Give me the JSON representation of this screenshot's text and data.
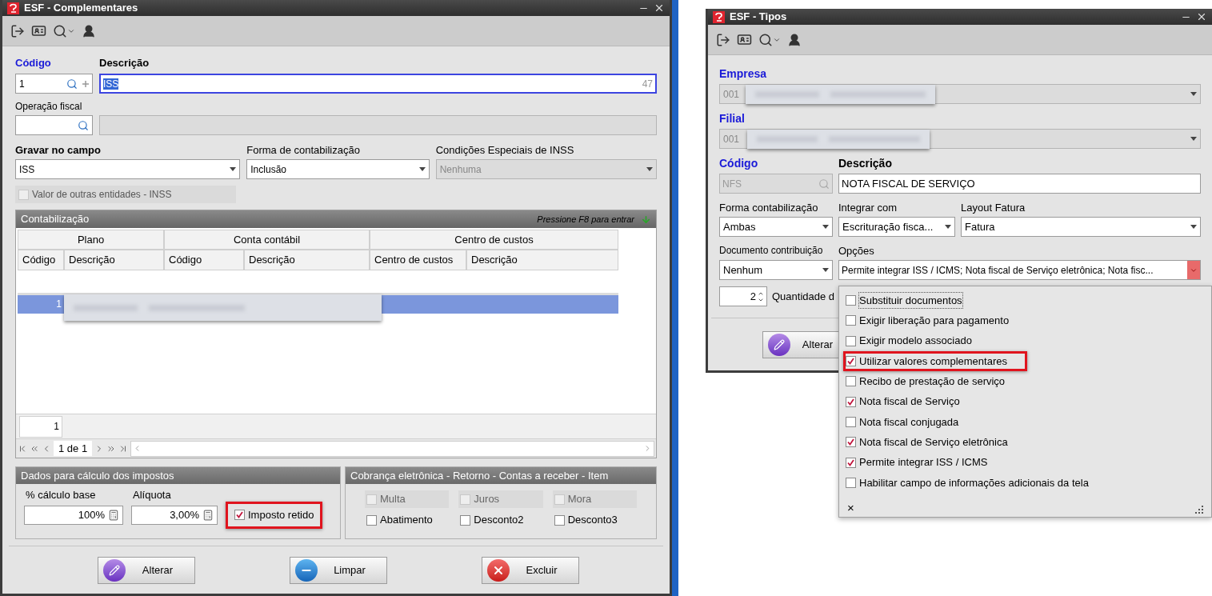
{
  "complementares_window": {
    "title": "ESF - Complementares",
    "codigo": {
      "label": "Código",
      "value": "1"
    },
    "descricao": {
      "label": "Descrição",
      "value": "ISS",
      "counter": "47",
      "focused": true,
      "text_selected": true
    },
    "operacao_fiscal": {
      "label": "Operação fiscal"
    },
    "selects": [
      {
        "label": "Gravar no campo",
        "value": "ISS",
        "bold": true,
        "disabled": false
      },
      {
        "label": "Forma de contabilização",
        "value": "Inclusão",
        "bold": false,
        "disabled": false
      },
      {
        "label": "Condições Especiais de INSS",
        "value": "Nenhuma",
        "bold": false,
        "disabled": true
      }
    ],
    "outras_entidades": {
      "label": "Valor de outras entidades - INSS",
      "checked": false,
      "disabled": true
    },
    "contabilizacao": {
      "title": "Contabilização",
      "hint": "Pressione F8 para entrar",
      "group_headers": [
        "Plano",
        "Conta contábil",
        "Centro de custos"
      ],
      "columns": [
        "Código",
        "Descrição",
        "Código",
        "Descrição",
        "Centro de custos",
        "Descrição"
      ],
      "rows": [
        {
          "codigo": "1",
          "selected": true
        }
      ],
      "footer_count": "1",
      "pager": "1 de 1"
    },
    "impostos": {
      "title": "Dados para cálculo dos impostos",
      "fields": [
        {
          "label": "% cálculo base",
          "value": "100%"
        },
        {
          "label": "Alíquota",
          "value": "3,00%"
        }
      ],
      "imposto_retido": {
        "label": "Imposto retido",
        "checked": true,
        "highlighted": true
      }
    },
    "cobranca": {
      "title": "Cobrança eletrônica - Retorno - Contas a receber - Item",
      "options": [
        {
          "label": "Multa",
          "checked": false,
          "disabled": true
        },
        {
          "label": "Juros",
          "checked": false,
          "disabled": true
        },
        {
          "label": "Mora",
          "checked": false,
          "disabled": true
        },
        {
          "label": "Abatimento",
          "checked": false,
          "disabled": false
        },
        {
          "label": "Desconto2",
          "checked": false,
          "disabled": false
        },
        {
          "label": "Desconto3",
          "checked": false,
          "disabled": false
        }
      ]
    },
    "buttons": [
      {
        "label": "Alterar",
        "kind": "edit"
      },
      {
        "label": "Limpar",
        "kind": "clear"
      },
      {
        "label": "Excluir",
        "kind": "delete"
      }
    ]
  },
  "tipos_window": {
    "title": "ESF - Tipos",
    "empresa": {
      "label": "Empresa",
      "value": "001"
    },
    "filial": {
      "label": "Filial",
      "value": "001"
    },
    "codigo": {
      "label": "Código",
      "value": "NFS"
    },
    "descricao": {
      "label": "Descrição",
      "value": "NOTA FISCAL DE SERVIÇO"
    },
    "forma_contabilizacao": {
      "label": "Forma contabilização",
      "value": "Ambas"
    },
    "integrar_com": {
      "label": "Integrar com",
      "value": "Escrituração fisca..."
    },
    "layout_fatura": {
      "label": "Layout Fatura",
      "value": "Fatura"
    },
    "documento_contribuicao": {
      "label": "Documento contribuição",
      "value": "Nenhum"
    },
    "opcoes": {
      "label": "Opções",
      "value": "Permite integrar ISS / ICMS; Nota fiscal de Serviço eletrônica; Nota fisc..."
    },
    "quantidade": {
      "value": "2",
      "label": "Quantidade d"
    },
    "button": {
      "label": "Alterar",
      "kind": "edit"
    },
    "options_dropdown": {
      "close": "×",
      "items": [
        {
          "label": "Substituir documentos",
          "checked": false,
          "highlighted": false
        },
        {
          "label": "Exigir liberação para pagamento",
          "checked": false,
          "highlighted": false
        },
        {
          "label": "Exigir modelo associado",
          "checked": false,
          "highlighted": false
        },
        {
          "label": "Utilizar valores complementares",
          "checked": true,
          "highlighted": true
        },
        {
          "label": "Recibo de prestação de serviço",
          "checked": false,
          "highlighted": false
        },
        {
          "label": "Nota fiscal de Serviço",
          "checked": true,
          "highlighted": false
        },
        {
          "label": "Nota fiscal conjugada",
          "checked": false,
          "highlighted": false
        },
        {
          "label": "Nota fiscal de Serviço eletrônica",
          "checked": true,
          "highlighted": false
        },
        {
          "label": "Permite integrar ISS / ICMS",
          "checked": true,
          "highlighted": false
        },
        {
          "label": "Habilitar campo de informações adicionais da tela",
          "checked": false,
          "highlighted": false
        }
      ]
    }
  }
}
